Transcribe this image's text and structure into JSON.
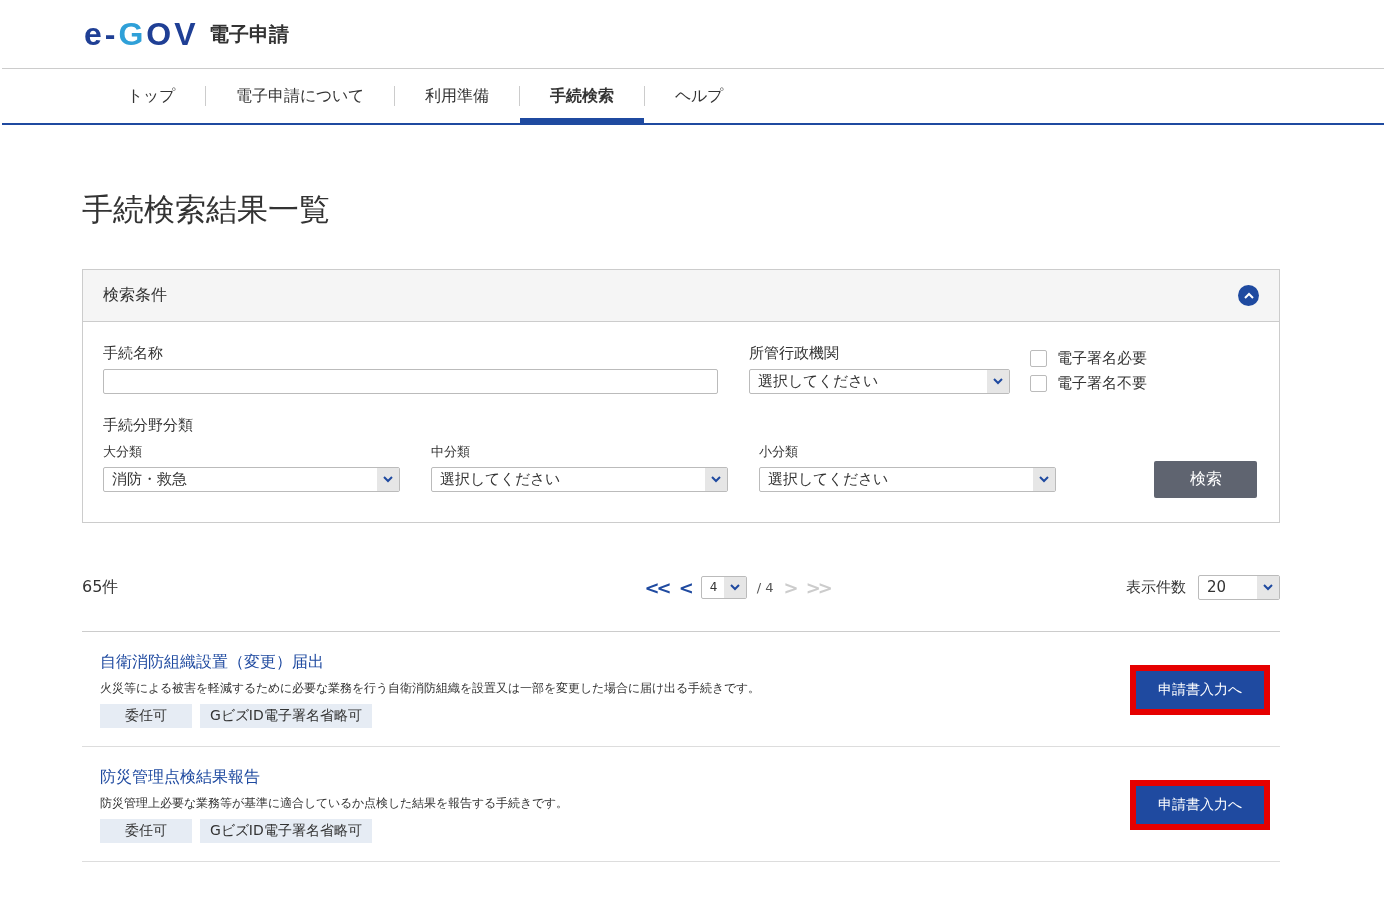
{
  "logo": {
    "parts": [
      {
        "text": "e-",
        "color": "#1f3f95"
      },
      {
        "text": "G",
        "color": "#2fa0d8"
      },
      {
        "text": "OV",
        "color": "#1f3f95"
      }
    ],
    "service": "電子申請"
  },
  "nav": [
    {
      "label": "トップ",
      "selected": false
    },
    {
      "label": "電子申請について",
      "selected": false
    },
    {
      "label": "利用準備",
      "selected": false
    },
    {
      "label": "手続検索",
      "selected": true
    },
    {
      "label": "ヘルプ",
      "selected": false
    }
  ],
  "page_title": "手続検索結果一覧",
  "search_panel": {
    "title": "検索条件",
    "expanded": true,
    "name_field": {
      "label": "手続名称"
    },
    "agency_field": {
      "label": "所管行政機関",
      "value": "選択してください"
    },
    "checkboxes": [
      {
        "label": "電子署名必要",
        "checked": false
      },
      {
        "label": "電子署名不要",
        "checked": false
      }
    ],
    "category_heading": "手続分野分類",
    "categories": [
      {
        "label": "大分類",
        "value": "消防・救急"
      },
      {
        "label": "中分類",
        "value": "選択してください"
      },
      {
        "label": "小分類",
        "value": "選択してください"
      }
    ],
    "search_button": "検索"
  },
  "result_count": "65件",
  "pagination": {
    "first": {
      "symbol": "<<",
      "disabled": false
    },
    "prev": {
      "symbol": "<",
      "disabled": false
    },
    "page": "4",
    "total": "/ 4",
    "next": {
      "symbol": ">",
      "disabled": true
    },
    "last": {
      "symbol": ">>",
      "disabled": true
    }
  },
  "page_size": {
    "label": "表示件数",
    "value": "20"
  },
  "results": [
    {
      "title": "自衛消防組織設置（変更）届出",
      "description": "火災等による被害を軽減するために必要な業務を行う自衛消防組織を設置又は一部を変更した場合に届け出る手続きです。",
      "tags": [
        "委任可",
        "GビズID電子署名省略可"
      ],
      "button": "申請書入力へ",
      "highlighted": true
    },
    {
      "title": "防災管理点検結果報告",
      "description": "防災管理上必要な業務等が基準に適合しているか点検した結果を報告する手続きです。",
      "tags": [
        "委任可",
        "GビズID電子署名省略可"
      ],
      "button": "申請書入力へ",
      "highlighted": true
    }
  ]
}
